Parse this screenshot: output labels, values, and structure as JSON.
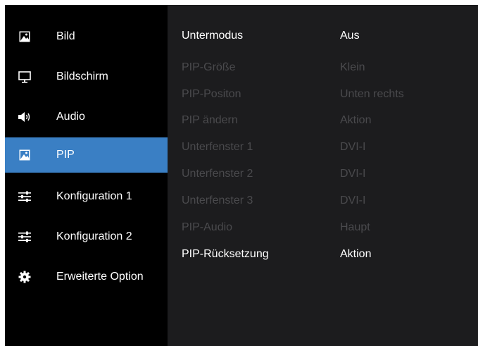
{
  "sidebar": {
    "items": [
      {
        "label": "Bild",
        "icon": "picture-icon"
      },
      {
        "label": "Bildschirm",
        "icon": "monitor-icon"
      },
      {
        "label": "Audio",
        "icon": "speaker-icon"
      },
      {
        "label": "PIP",
        "icon": "picture-icon",
        "active": true
      },
      {
        "label": "Konfiguration 1",
        "icon": "sliders-icon"
      },
      {
        "label": "Konfiguration 2",
        "icon": "sliders-icon"
      },
      {
        "label": "Erweiterte Option",
        "icon": "gear-icon"
      }
    ]
  },
  "settings": {
    "rows": [
      {
        "label": "Untermodus",
        "value": "Aus",
        "enabled": true
      },
      {
        "label": "PIP-Größe",
        "value": "Klein",
        "enabled": false
      },
      {
        "label": "PIP-Positon",
        "value": "Unten rechts",
        "enabled": false
      },
      {
        "label": "PIP ändern",
        "value": "Aktion",
        "enabled": false
      },
      {
        "label": "Unterfenster 1",
        "value": "DVI-I",
        "enabled": false
      },
      {
        "label": "Unterfenster 2",
        "value": "DVI-I",
        "enabled": false
      },
      {
        "label": "Unterfenster 3",
        "value": "DVI-I",
        "enabled": false
      },
      {
        "label": "PIP-Audio",
        "value": "Haupt",
        "enabled": false
      },
      {
        "label": "PIP-Rücksetzung",
        "value": "Aktion",
        "enabled": true
      }
    ]
  },
  "colors": {
    "sidebar_bg": "#000000",
    "content_bg": "#1c1c1e",
    "active_bg": "#3a7fc4",
    "text_enabled": "#ffffff",
    "text_disabled": "#4a4a4d"
  }
}
